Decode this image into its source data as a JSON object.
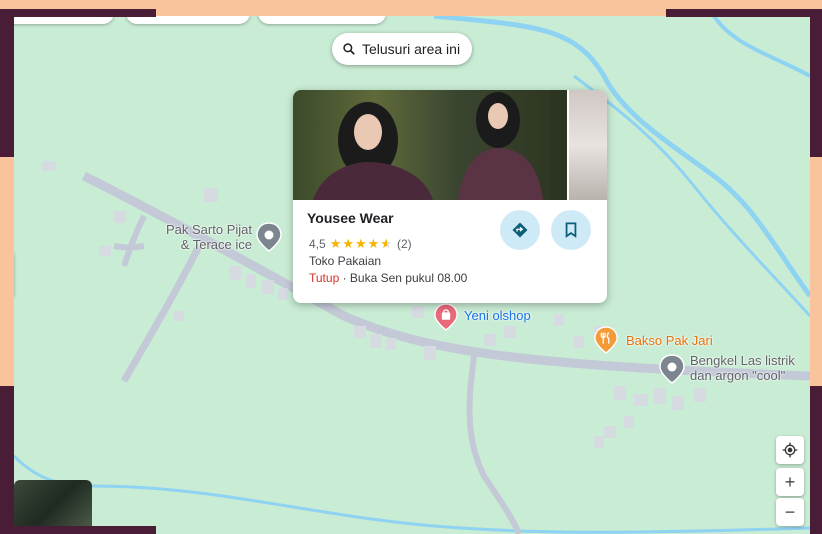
{
  "map_search_button": {
    "label": "Telusuri area ini",
    "icon": "search-icon"
  },
  "place_card": {
    "name": "Yousee Wear",
    "rating": "4,5",
    "stars_value": 4.5,
    "review_count": "(2)",
    "category": "Toko Pakaian",
    "status": "Tutup",
    "hours_separator": " · ",
    "hours_text": "Buka Sen pukul 08.00",
    "directions_icon": "directions-icon",
    "save_icon": "bookmark-icon"
  },
  "places": [
    {
      "name": "Pak Sarto Pijat\n& Terace ice",
      "line1": "Pak Sarto Pijat",
      "line2": "& Terace ice",
      "color": "#5f6368",
      "icon": "pin-icon"
    },
    {
      "name": "Yeni olshop",
      "color": "#1a73e8",
      "icon": "shopping-bag-icon",
      "pin_color": "#e8697a"
    },
    {
      "name": "Bakso Pak Jari",
      "color": "#e8710a",
      "icon": "restaurant-icon",
      "pin_color": "#f29b38"
    },
    {
      "line1": "Bengkel Las listrik",
      "line2": "dan argon \"cool\"",
      "color": "#5f6368",
      "icon": "pin-icon"
    }
  ],
  "controls": {
    "locate_icon": "my-location-icon",
    "zoom_in_label": "+",
    "zoom_out_label": "−"
  },
  "colors": {
    "map_bg": "#c9ecd4",
    "road": "#c3c9d6",
    "water": "#8fd3f2",
    "frame": "#4a1d36",
    "border": "#f9c49b"
  }
}
